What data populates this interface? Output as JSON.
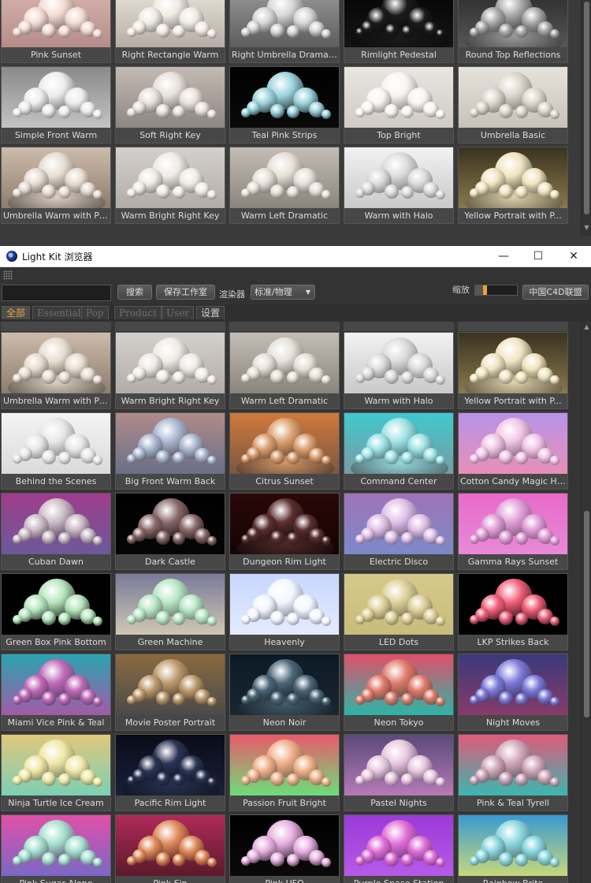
{
  "top_panel": {
    "rows": [
      [
        {
          "label": "Pink Sunset",
          "bg": [
            "#d9b6b0",
            "#b58c88"
          ],
          "sp": "#f4dcd6",
          "ped": false
        },
        {
          "label": "Right Rectangle Warm",
          "bg": [
            "#eae4dc",
            "#b5ada3"
          ],
          "sp": "#f0ebe4",
          "ped": false
        },
        {
          "label": "Right Umbrella Dramatic",
          "bg": [
            "#9a9a9a",
            "#5c5c5c"
          ],
          "sp": "#d7d7d7",
          "ped": false
        },
        {
          "label": "Rimlight Pedestal",
          "bg": [
            "#050505",
            "#141414"
          ],
          "sp": "#1b1b1b",
          "ped": true
        },
        {
          "label": "Round Top Reflections",
          "bg": [
            "#2a2a2a",
            "#565656"
          ],
          "sp": "#a9a9a9",
          "ped": true
        }
      ],
      [
        {
          "label": "Simple Front Warm",
          "bg": [
            "#8a8a8a",
            "#c4c4c4"
          ],
          "sp": "#ededed",
          "ped": false
        },
        {
          "label": "Soft Right Key",
          "bg": [
            "#c3bbb3",
            "#8d8580"
          ],
          "sp": "#e7e1da",
          "ped": false
        },
        {
          "label": "Teal Pink Strips",
          "bg": [
            "#000000",
            "#0a0a0a"
          ],
          "sp": "#9cd4de",
          "ped": false
        },
        {
          "label": "Top Bright",
          "bg": [
            "#e9e6e2",
            "#cfcac4"
          ],
          "sp": "#f7f5f2",
          "ped": false
        },
        {
          "label": "Umbrella Basic",
          "bg": [
            "#e6e2dc",
            "#c8c1b8"
          ],
          "sp": "#ddd6cd",
          "ped": false
        }
      ],
      [
        {
          "label": "Umbrella Warm with Ped...",
          "bg": [
            "#cdbcab",
            "#8c7c6c"
          ],
          "sp": "#e7ddd1",
          "ped": true
        },
        {
          "label": "Warm Bright Right Key",
          "bg": [
            "#d4d0cc",
            "#b2aca7"
          ],
          "sp": "#efebe6",
          "ped": false
        },
        {
          "label": "Warm Left Dramatic",
          "bg": [
            "#c3bdb5",
            "#8b847c"
          ],
          "sp": "#e6e0d8",
          "ped": false
        },
        {
          "label": "Warm with Halo",
          "bg": [
            "#f2f2f2",
            "#c9c9c9"
          ],
          "sp": "#dcdcdc",
          "ped": false
        },
        {
          "label": "Yellow Portrait with P...",
          "bg": [
            "#3b3320",
            "#8a7a4c"
          ],
          "sp": "#efe5c2",
          "ped": true
        }
      ]
    ]
  },
  "window": {
    "title": "Light Kit 浏览器",
    "minimize": "—",
    "maximize": "☐",
    "close": "✕"
  },
  "toolbar": {
    "search_value": "",
    "search_button": "搜索",
    "save_workspace_button": "保存工作室",
    "renderer_label": "渲染器",
    "renderer_value": "标准/物理",
    "zoom_label": "缩放",
    "zoom_level": 0.22,
    "c4d_button": "中国C4D联盟"
  },
  "tabs": [
    {
      "label": "全部",
      "active": true
    },
    {
      "label": "Essential",
      "active": false
    },
    {
      "label": "Pop",
      "active": false
    },
    {
      "label": "Product",
      "active": false
    },
    {
      "label": "User",
      "active": false
    },
    {
      "label": "设置",
      "active": false
    }
  ],
  "content": {
    "rows": [
      [
        {
          "label": "Umbrella Warm with Ped...",
          "bg": [
            "#cdbcab",
            "#8c7c6c"
          ],
          "sp": "#e7ddd1",
          "ped": true
        },
        {
          "label": "Warm Bright Right Key",
          "bg": [
            "#d4d0cc",
            "#b2aca7"
          ],
          "sp": "#efebe6",
          "ped": false
        },
        {
          "label": "Warm Left Dramatic",
          "bg": [
            "#c3bdb5",
            "#8b847c"
          ],
          "sp": "#e6e0d8",
          "ped": false
        },
        {
          "label": "Warm with Halo",
          "bg": [
            "#f2f2f2",
            "#c9c9c9"
          ],
          "sp": "#dcdcdc",
          "ped": false
        },
        {
          "label": "Yellow Portrait with P...",
          "bg": [
            "#3b3320",
            "#8a7a4c"
          ],
          "sp": "#efe5c2",
          "ped": true
        }
      ],
      [
        {
          "label": "Behind the Scenes",
          "bg": [
            "#f4f4f4",
            "#dadada"
          ],
          "sp": "#e8e8e8",
          "ped": false
        },
        {
          "label": "Big Front Warm Back",
          "bg": [
            "#b08a8a",
            "#6a6f88"
          ],
          "sp": "#a9b7cf",
          "ped": false
        },
        {
          "label": "Citrus Sunset",
          "bg": [
            "#d07a3c",
            "#7b5640"
          ],
          "sp": "#dba070",
          "ped": true
        },
        {
          "label": "Command Center",
          "bg": [
            "#3fc9cf",
            "#7a9aa4"
          ],
          "sp": "#9fe3e6",
          "ped": true
        },
        {
          "label": "Cotton Candy Magic Hour",
          "bg": [
            "#b893e8",
            "#e88fb5"
          ],
          "sp": "#f2c6e6",
          "ped": false
        }
      ],
      [
        {
          "label": "Cuban Dawn",
          "bg": [
            "#a03c8c",
            "#6a5a9a"
          ],
          "sp": "#cbbcc6",
          "ped": false
        },
        {
          "label": "Dark Castle",
          "bg": [
            "#000000",
            "#050505"
          ],
          "sp": "#8a6a6a",
          "ped": false
        },
        {
          "label": "Dungeon Rim Light",
          "bg": [
            "#2a0808",
            "#140404"
          ],
          "sp": "#5a2f2f",
          "ped": true
        },
        {
          "label": "Electric Disco",
          "bg": [
            "#a073b8",
            "#7a8ac8"
          ],
          "sp": "#e0c0e8",
          "ped": false
        },
        {
          "label": "Gamma Rays Sunset",
          "bg": [
            "#e86ac8",
            "#e88ad8"
          ],
          "sp": "#e0a0d8",
          "ped": false
        }
      ],
      [
        {
          "label": "Green Box Pink Bottom",
          "bg": [
            "#000000",
            "#000000"
          ],
          "sp": "#b6e6bd",
          "ped": false
        },
        {
          "label": "Green Machine",
          "bg": [
            "#7a7a9a",
            "#d0c8b4"
          ],
          "sp": "#b8e8c6",
          "ped": false
        },
        {
          "label": "Heavenly",
          "bg": [
            "#c8d6ff",
            "#e4ecff"
          ],
          "sp": "#f3f6ff",
          "ped": false
        },
        {
          "label": "LED Dots",
          "bg": [
            "#d6c888",
            "#c8bc7c"
          ],
          "sp": "#ddd09a",
          "ped": false
        },
        {
          "label": "LKP Strikes Back",
          "bg": [
            "#000000",
            "#000000"
          ],
          "sp": "#f0607a",
          "ped": false
        }
      ],
      [
        {
          "label": "Miami Vice Pink & Teal",
          "bg": [
            "#2aa4b0",
            "#a35aa8"
          ],
          "sp": "#c06ab8",
          "ped": false
        },
        {
          "label": "Movie Poster Portrait",
          "bg": [
            "#8a6a40",
            "#4a4a4a"
          ],
          "sp": "#bd9a6e",
          "ped": false
        },
        {
          "label": "Neon Noir",
          "bg": [
            "#0c1a26",
            "#1a2630"
          ],
          "sp": "#4b6677",
          "ped": true
        },
        {
          "label": "Neon Tokyo",
          "bg": [
            "#e0506a",
            "#2ab6a8"
          ],
          "sp": "#e07a6a",
          "ped": false
        },
        {
          "label": "Night Moves",
          "bg": [
            "#3a3a7a",
            "#8a3a6a"
          ],
          "sp": "#7a7ad8",
          "ped": false
        }
      ],
      [
        {
          "label": "Ninja Turtle Ice Cream",
          "bg": [
            "#e0c87a",
            "#7ad0b6"
          ],
          "sp": "#f0e8a8",
          "ped": false
        },
        {
          "label": "Pacific Rim Light",
          "bg": [
            "#0a0c18",
            "#18203a"
          ],
          "sp": "#2a3454",
          "ped": true
        },
        {
          "label": "Passion Fruit Bright",
          "bg": [
            "#ea5a6a",
            "#6ae07a"
          ],
          "sp": "#f0b08a",
          "ped": false
        },
        {
          "label": "Pastel Nights",
          "bg": [
            "#5a4a7a",
            "#b87ab8"
          ],
          "sp": "#e8c8e0",
          "ped": false
        },
        {
          "label": "Pink & Teal Tyrell",
          "bg": [
            "#e05a7a",
            "#38b8b0"
          ],
          "sp": "#d0a6b8",
          "ped": false
        }
      ],
      [
        {
          "label": "Pink Sugar Alone",
          "bg": [
            "#e050a8",
            "#7a68c8"
          ],
          "sp": "#a6e0d0",
          "ped": false
        },
        {
          "label": "Pink Sin",
          "bg": [
            "#b02a5a",
            "#5a1a2a"
          ],
          "sp": "#e08a5a",
          "ped": false
        },
        {
          "label": "Pink UFO",
          "bg": [
            "#000000",
            "#0a0a0a"
          ],
          "sp": "#e8b0e0",
          "ped": false
        },
        {
          "label": "Purple Space Station",
          "bg": [
            "#9a3ad8",
            "#b85ae8"
          ],
          "sp": "#e070d8",
          "ped": false
        },
        {
          "label": "Rainbow Brite",
          "bg": [
            "#3a9ad0",
            "#c8d87a"
          ],
          "sp": "#8ad6e0",
          "ped": false
        }
      ]
    ]
  }
}
